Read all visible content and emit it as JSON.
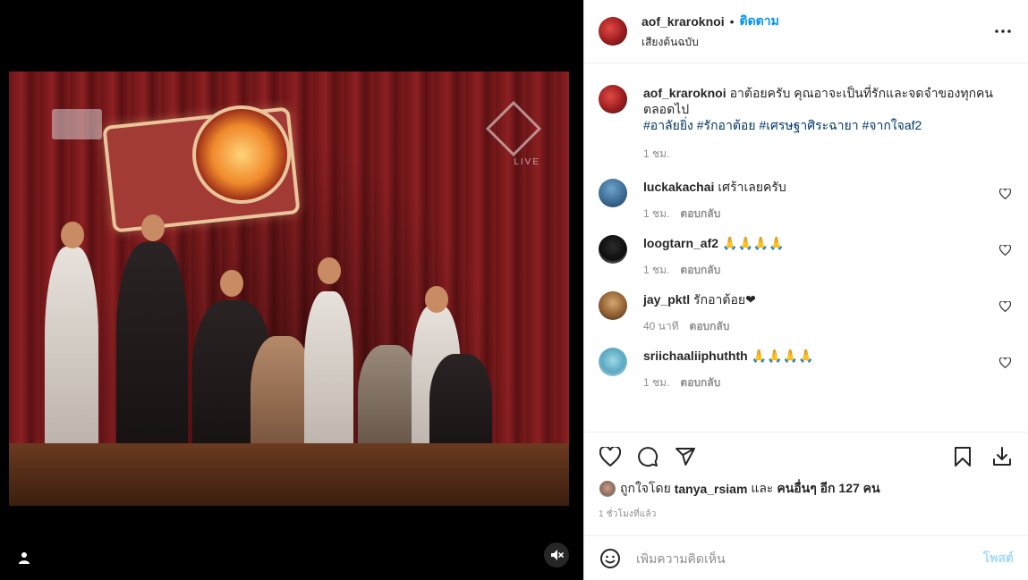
{
  "post": {
    "author": "aof_kraroknoi",
    "follow_label": "ติดตาม",
    "audio_label": "เสียงต้นฉบับ",
    "separator": "•"
  },
  "caption": {
    "username": "aof_kraroknoi",
    "text": "อาต้อยครับ คุณอาจะเป็นที่รักและจดจำของทุกคน ตลอดไป",
    "hashtags": "#อาลัยยิ่ง #รักอาต้อย #เศรษฐาศิระฉายา #จากใจaf2",
    "time": "1 ชม."
  },
  "comments": [
    {
      "username": "luckakachai",
      "text": "เศร้าเลยครับ",
      "time": "1 ชม.",
      "reply": "ตอบกลับ"
    },
    {
      "username": "loogtarn_af2",
      "text": "🙏🙏🙏🙏",
      "time": "1 ชม.",
      "reply": "ตอบกลับ"
    },
    {
      "username": "jay_pktl",
      "text": "รักอาต้อย❤",
      "time": "40 นาที",
      "reply": "ตอบกลับ"
    },
    {
      "username": "sriichaaliiphuthth",
      "text": "🙏🙏🙏🙏",
      "time": "1 ชม.",
      "reply": "ตอบกลับ"
    }
  ],
  "likes": {
    "prefix": "ถูกใจโดย",
    "user": "tanya_rsiam",
    "conj": "และ",
    "others": "คนอื่นๆ อีก 127 คน"
  },
  "timestamp": "1 ชั่วโมงที่แล้ว",
  "composer": {
    "placeholder": "เพิ่มความคิดเห็น",
    "post_label": "โพสต์"
  },
  "video_overlay": {
    "live_label": "LIVE"
  },
  "colors": {
    "link": "#0095f6",
    "hashtag": "#00376b",
    "muted": "#8e8e8e"
  },
  "icons": [
    "user-tag-icon",
    "muted-speaker-icon",
    "more-options-icon",
    "heart-icon",
    "comment-icon",
    "share-icon",
    "bookmark-icon",
    "download-icon",
    "emoji-icon"
  ]
}
